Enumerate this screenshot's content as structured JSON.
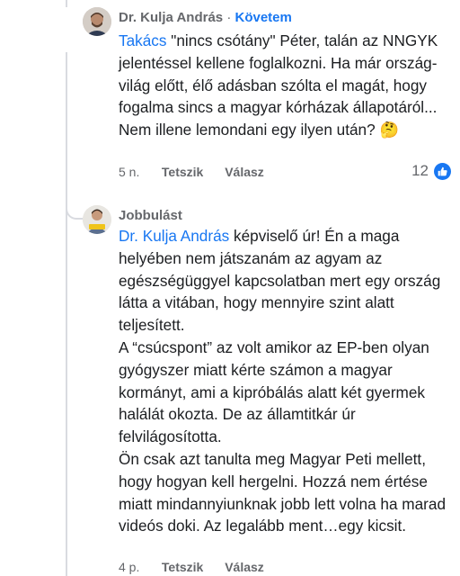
{
  "comments": [
    {
      "author": "Dr. Kulja András",
      "separator": "·",
      "follow_label": "Követem",
      "mention": "Takács",
      "text": " \"nincs csótány\" Péter, talán az NNGYK jelentéssel kellene foglalkozni. Ha már ország-világ előtt, élő adásban szólta el magát, hogy fogalma sincs a magyar kórházak állapotáról... Nem illene lemondani egy ilyen után? 🤔",
      "time": "5 n.",
      "like_label": "Tetszik",
      "reply_label": "Válasz",
      "reaction_count": "12",
      "reaction_icon": "like-icon"
    },
    {
      "author": "Jobbulást",
      "mention": "Dr. Kulja András",
      "paragraph1": " képviselő úr! Én a maga helyében nem játszanám az agyam az egészségüggyel kapcsolatban mert egy ország látta a vitában, hogy mennyire szint alatt teljesített.",
      "paragraph2": "A “csúcspont” az volt amikor az EP-ben olyan gyógyszer miatt kérte számon a magyar kormányt, ami a kipróbálás alatt két gyermek halálát okozta. De az államtitkár úr felvilágosította.",
      "paragraph3": "Ön csak azt tanulta meg Magyar Peti mellett, hogy hogyan kell hergelni. Hozzá nem értése miatt mindannyiunknak jobb lett volna ha marad videós doki. Az legalább ment…egy kicsit.",
      "time": "4 p.",
      "like_label": "Tetszik",
      "reply_label": "Válasz"
    }
  ],
  "colors": {
    "link": "#1877f2",
    "meta": "#65676b",
    "text": "#1c1e21",
    "thread": "#d9dbe0"
  }
}
